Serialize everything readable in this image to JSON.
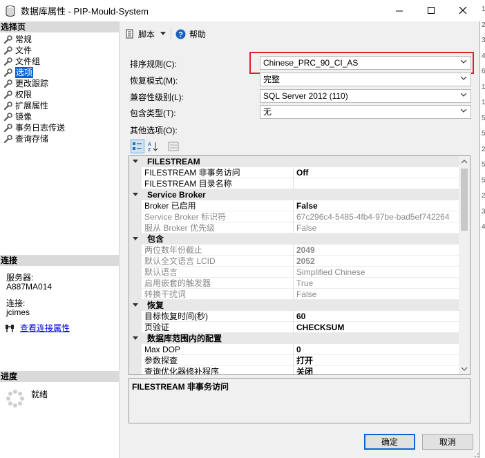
{
  "window": {
    "title": "数据库属性 - PIP-Mould-System"
  },
  "left": {
    "select_page_header": "选择页",
    "pages": [
      {
        "label": "常规",
        "name": "general"
      },
      {
        "label": "文件",
        "name": "files"
      },
      {
        "label": "文件组",
        "name": "filegroups"
      },
      {
        "label": "选项",
        "name": "options"
      },
      {
        "label": "更改跟踪",
        "name": "change-tracking"
      },
      {
        "label": "权限",
        "name": "permissions"
      },
      {
        "label": "扩展属性",
        "name": "extended-properties"
      },
      {
        "label": "镜像",
        "name": "mirroring"
      },
      {
        "label": "事务日志传送",
        "name": "log-shipping"
      },
      {
        "label": "查询存储",
        "name": "query-store"
      }
    ],
    "connection_header": "连接",
    "server_label": "服务器:",
    "server_value": "A887MA014",
    "connection_label": "连接:",
    "connection_value": "jcimes",
    "view_connection_link": "查看连接属性",
    "progress_header": "进度",
    "progress_status": "就绪"
  },
  "toolbar": {
    "script_label": "脚本",
    "help_label": "帮助"
  },
  "form": {
    "collation_label": "排序规则(C):",
    "collation_value": "Chinese_PRC_90_CI_AS",
    "recovery_label": "恢复模式(M):",
    "recovery_value": "完整",
    "compat_label": "兼容性级别(L):",
    "compat_value": "SQL Server 2012 (110)",
    "containment_label": "包含类型(T):",
    "containment_value": "无",
    "other_options_label": "其他选项(O):"
  },
  "grid": {
    "rows": [
      {
        "type": "cat",
        "name": "FILESTREAM"
      },
      {
        "type": "prop",
        "name": "FILESTREAM 非事务访问",
        "value": "Off",
        "ro": false,
        "bold": true
      },
      {
        "type": "prop",
        "name": "FILESTREAM 目录名称",
        "value": "",
        "ro": false,
        "bold": false
      },
      {
        "type": "cat",
        "name": "Service Broker"
      },
      {
        "type": "prop",
        "name": "Broker 已启用",
        "value": "False",
        "ro": false,
        "bold": true
      },
      {
        "type": "prop",
        "name": "Service Broker 标识符",
        "value": "67c296c4-5485-4fb4-97be-bad5ef742264",
        "ro": true,
        "bold": false
      },
      {
        "type": "prop",
        "name": "服从 Broker 优先级",
        "value": "False",
        "ro": true,
        "bold": false
      },
      {
        "type": "cat",
        "name": "包含"
      },
      {
        "type": "prop",
        "name": "两位数年份截止",
        "value": "2049",
        "ro": true,
        "bold": true
      },
      {
        "type": "prop",
        "name": "默认全文语言 LCID",
        "value": "2052",
        "ro": true,
        "bold": true
      },
      {
        "type": "prop",
        "name": "默认语言",
        "value": "Simplified Chinese",
        "ro": true,
        "bold": false
      },
      {
        "type": "prop",
        "name": "启用嵌套的触发器",
        "value": "True",
        "ro": true,
        "bold": false
      },
      {
        "type": "prop",
        "name": "转换干扰词",
        "value": "False",
        "ro": true,
        "bold": false
      },
      {
        "type": "cat",
        "name": "恢复"
      },
      {
        "type": "prop",
        "name": "目标恢复时间(秒)",
        "value": "60",
        "ro": false,
        "bold": true
      },
      {
        "type": "prop",
        "name": "页验证",
        "value": "CHECKSUM",
        "ro": false,
        "bold": true
      },
      {
        "type": "cat",
        "name": "数据库范围内的配置"
      },
      {
        "type": "prop",
        "name": "Max DOP",
        "value": "0",
        "ro": false,
        "bold": true
      },
      {
        "type": "prop",
        "name": "参数探查",
        "value": "打开",
        "ro": false,
        "bold": true
      },
      {
        "type": "prop",
        "name": "查询优化器修补程序",
        "value": "关闭",
        "ro": false,
        "bold": true
      }
    ]
  },
  "description": {
    "title": "FILESTREAM 非事务访问"
  },
  "buttons": {
    "ok": "确定",
    "cancel": "取消"
  },
  "right_edge_digits": [
    "1",
    "2",
    "3",
    "4",
    "6",
    "1",
    "1",
    "5",
    "5",
    "2",
    "5",
    "5",
    "2",
    "3",
    "4"
  ]
}
